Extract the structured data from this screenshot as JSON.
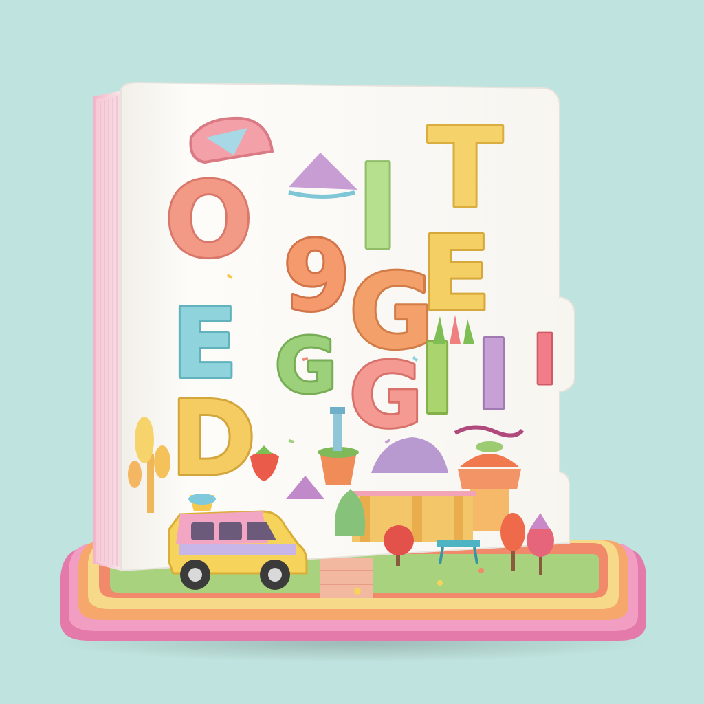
{
  "scene": {
    "background": "#bfe3de",
    "subject": "toy-board-book-diorama",
    "book_page": "#fbfaf6",
    "base_colors": {
      "pink": "#ea86b4",
      "orange": "#f3a56a",
      "yellow": "#f6d77c",
      "green": "#9ccb72"
    }
  },
  "letters": [
    {
      "char": "O",
      "color": "#f29a86"
    },
    {
      "char": "I",
      "color": "#b7e08e"
    },
    {
      "char": "T",
      "color": "#f6d26a"
    },
    {
      "char": "E",
      "color": "#f4cf63"
    },
    {
      "char": "G",
      "color": "#f3a06b"
    },
    {
      "char": "9",
      "color": "#f49a6d"
    },
    {
      "char": "E",
      "color": "#8fd4dd"
    },
    {
      "char": "G",
      "color": "#9cd07a"
    },
    {
      "char": "G",
      "color": "#f59a93"
    },
    {
      "char": "I",
      "color": "#a9d46e"
    },
    {
      "char": "I",
      "color": "#c7a0d6"
    },
    {
      "char": "I",
      "color": "#f07d87"
    },
    {
      "char": "D",
      "color": "#f4cc62"
    }
  ],
  "van": {
    "plate_text": ""
  }
}
